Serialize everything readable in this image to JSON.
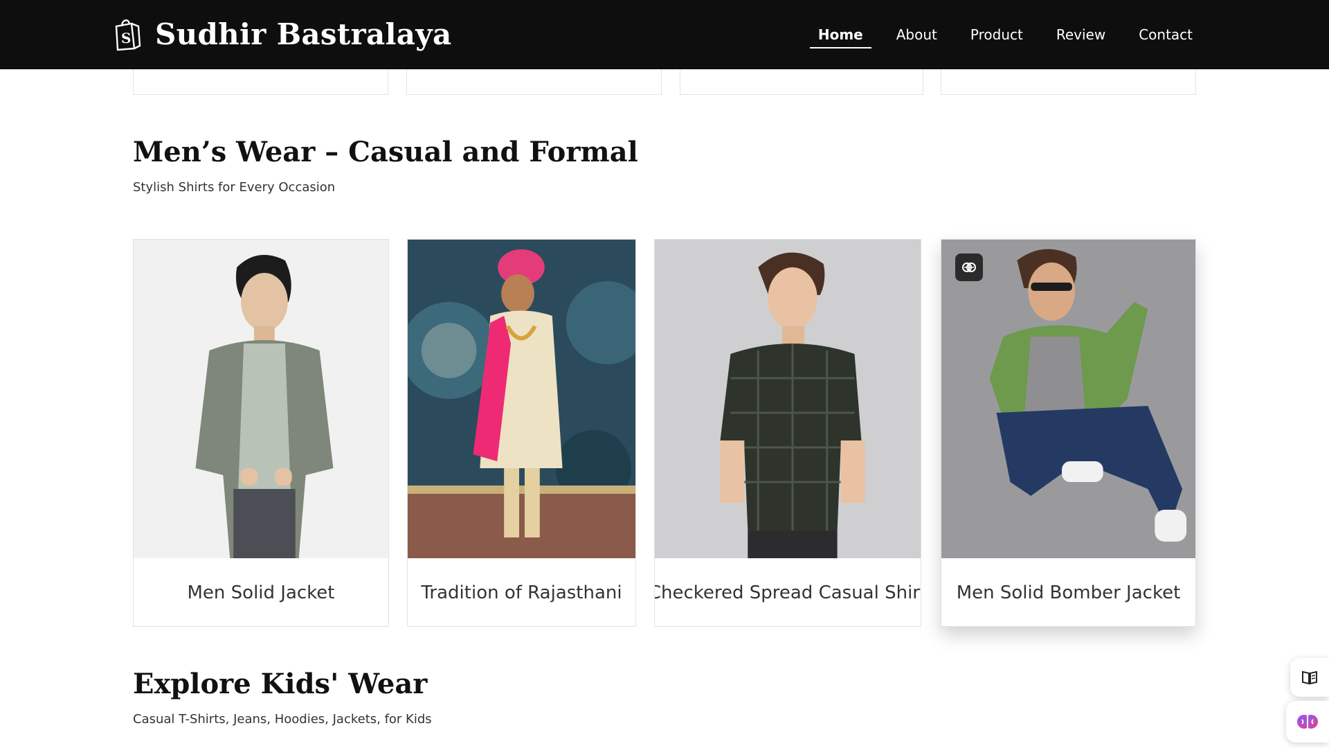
{
  "brand": {
    "name": "Sudhir Bastralaya",
    "logo_icon": "shopping-bag-logo-icon"
  },
  "nav": {
    "items": [
      {
        "label": "Home",
        "active": true
      },
      {
        "label": "About",
        "active": false
      },
      {
        "label": "Product",
        "active": false
      },
      {
        "label": "Review",
        "active": false
      },
      {
        "label": "Contact",
        "active": false
      }
    ]
  },
  "mens_section": {
    "title": "Men’s Wear – Casual and Formal",
    "subtitle": "Stylish Shirts for Every Occasion",
    "products": [
      {
        "title": "Men Solid Jacket"
      },
      {
        "title": "Tradition of Rajasthani"
      },
      {
        "title": "Checkered Spread Casual Shirt"
      },
      {
        "title": "Men Solid Bomber Jacket"
      }
    ]
  },
  "kids_section": {
    "title": "Explore Kids' Wear",
    "subtitle": "Casual T-Shirts, Jeans, Hoodies, Jackets, for Kids"
  },
  "widgets": {
    "reader_icon": "book-open-icon",
    "assistant_icon": "brain-icon",
    "badge_icon": "brain-icon"
  },
  "colors": {
    "navbar_bg": "#0e0e0e",
    "accent_purple": "#8a5cf5",
    "accent_pink": "#e7408b"
  }
}
